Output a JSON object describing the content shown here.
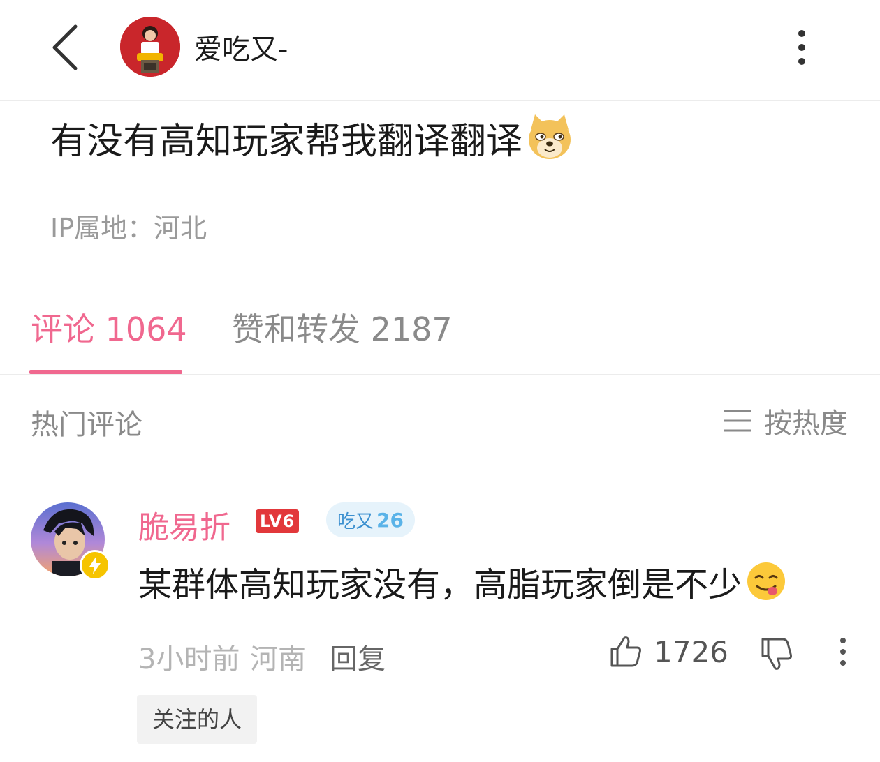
{
  "header": {
    "author_name": "爱吃又-",
    "back_icon": "chevron-left-icon",
    "more_icon": "more-vertical-icon"
  },
  "post": {
    "text": "有没有高知玩家帮我翻译翻译",
    "emoji": "doge-emoji-icon",
    "ip_location": "IP属地：河北"
  },
  "tabs": [
    {
      "label": "评论 1064",
      "active": true
    },
    {
      "label": "赞和转发 2187",
      "active": false
    }
  ],
  "comments_section": {
    "title": "热门评论",
    "sort_label": "按热度",
    "sort_icon": "menu-lines-icon"
  },
  "comment": {
    "username": "脆易折",
    "level": "LV6",
    "fan_badge_name": "吃又",
    "fan_badge_level": "26",
    "text": "某群体高知玩家没有，高脂玩家倒是不少",
    "emoji": "yum-emoji-icon",
    "time": "3小时前",
    "location": "河南",
    "reply_label": "回复",
    "like_count": "1726",
    "follow_tag": "关注的人"
  },
  "colors": {
    "accent": "#f0688f",
    "muted": "#8a8a8a",
    "level_badge": "#e2383b",
    "fan_badge_bg": "#e6f3fb"
  }
}
